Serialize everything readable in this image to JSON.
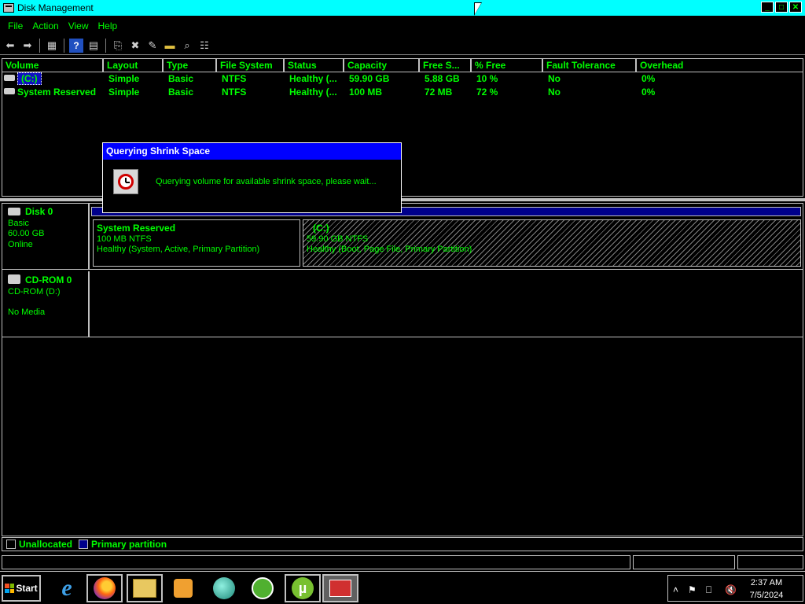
{
  "window": {
    "title": "Disk Management",
    "controls": {
      "minimize": "_",
      "maximize": "□",
      "close": "✕"
    }
  },
  "menubar": {
    "items": [
      "File",
      "Action",
      "View",
      "Help"
    ]
  },
  "toolbar": {
    "buttons": [
      "back-icon",
      "forward-icon",
      "console-tree-icon",
      "help-icon",
      "properties-icon",
      "refresh-icon",
      "delete-icon",
      "edit-icon",
      "open-icon",
      "search-icon",
      "export-icon"
    ]
  },
  "volume_list": {
    "columns": [
      "Volume",
      "Layout",
      "Type",
      "File System",
      "Status",
      "Capacity",
      "Free S...",
      "% Free",
      "Fault Tolerance",
      "Overhead"
    ],
    "rows": [
      [
        "(C:)",
        "Simple",
        "Basic",
        "NTFS",
        "Healthy (...",
        "59.90 GB",
        "5.88 GB",
        "10 %",
        "No",
        "0%"
      ],
      [
        "System Reserved",
        "Simple",
        "Basic",
        "NTFS",
        "Healthy (...",
        "100 MB",
        "72 MB",
        "72 %",
        "No",
        "0%"
      ]
    ]
  },
  "dialog": {
    "title": "Querying Shrink Space",
    "message": "Querying volume for available shrink space, please wait...",
    "icon": "clock-icon"
  },
  "disks": [
    {
      "name": "Disk 0",
      "type": "Basic",
      "size": "60.00 GB",
      "status": "Online",
      "partitions": [
        {
          "name": "System Reserved",
          "size_fs": "100 MB NTFS",
          "status": "Healthy (System, Active, Primary Partition)"
        },
        {
          "name": "(C:)",
          "size_fs": "59.90 GB NTFS",
          "status": "Healthy (Boot, Page File, Primary Partition)"
        }
      ]
    },
    {
      "name": "CD-ROM 0",
      "type": "CD-ROM (D:)",
      "status": "No Media"
    }
  ],
  "legend": {
    "unallocated": "Unallocated",
    "primary": "Primary partition"
  },
  "taskbar": {
    "start_label": "Start",
    "apps": [
      "internet-explorer-icon",
      "firefox-icon",
      "file-explorer-icon",
      "media-player-icon",
      "app-icon",
      "cc-cleaner-icon",
      "utorrent-icon",
      "computer-management-icon"
    ],
    "clock": {
      "time": "2:37 AM",
      "date": "7/5/2024"
    }
  },
  "colors": {
    "title_bar": "#00ffff",
    "text": "#00ff00",
    "dialog_title": "#0000ff",
    "primary_partition": "#00008b"
  }
}
